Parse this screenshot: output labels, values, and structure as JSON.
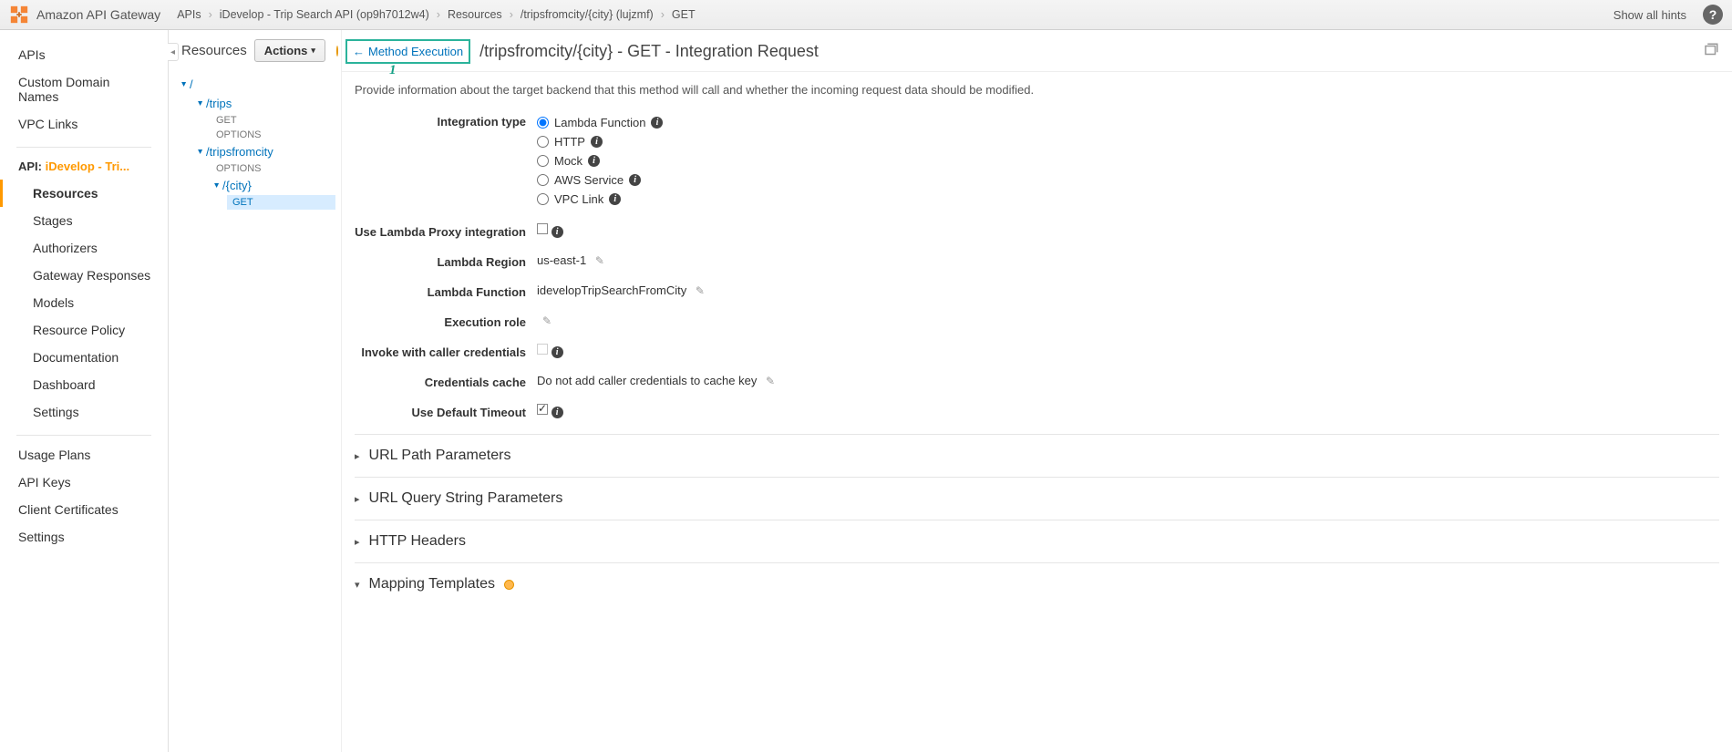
{
  "topbar": {
    "service_name": "Amazon API Gateway",
    "breadcrumbs": [
      "APIs",
      "iDevelop - Trip Search API (op9h7012w4)",
      "Resources",
      "/tripsfromcity/{city} (lujzmf)",
      "GET"
    ],
    "show_hints": "Show all hints"
  },
  "sidebar": {
    "items_top": [
      "APIs",
      "Custom Domain Names",
      "VPC Links"
    ],
    "api_prefix": "API:",
    "api_name": "iDevelop - Tri...",
    "api_items": [
      "Resources",
      "Stages",
      "Authorizers",
      "Gateway Responses",
      "Models",
      "Resource Policy",
      "Documentation",
      "Dashboard",
      "Settings"
    ],
    "items_bottom": [
      "Usage Plans",
      "API Keys",
      "Client Certificates",
      "Settings"
    ]
  },
  "resources": {
    "title": "Resources",
    "actions_label": "Actions",
    "tree": {
      "root": "/",
      "trips": "/trips",
      "trips_get": "GET",
      "trips_options": "OPTIONS",
      "tfc": "/tripsfromcity",
      "tfc_options": "OPTIONS",
      "city": "/{city}",
      "city_get": "GET"
    }
  },
  "main": {
    "back_link": "Method Execution",
    "annotation1": "1",
    "title": "/tripsfromcity/{city} - GET - Integration Request",
    "description": "Provide information about the target backend that this method will call and whether the incoming request data should be modified.",
    "labels": {
      "integration_type": "Integration type",
      "proxy": "Use Lambda Proxy integration",
      "region": "Lambda Region",
      "function": "Lambda Function",
      "exec_role": "Execution role",
      "invoke_caller": "Invoke with caller credentials",
      "cred_cache": "Credentials cache",
      "default_timeout": "Use Default Timeout"
    },
    "integration_options": [
      "Lambda Function",
      "HTTP",
      "Mock",
      "AWS Service",
      "VPC Link"
    ],
    "region_value": "us-east-1",
    "function_value": "idevelopTripSearchFromCity",
    "cred_cache_value": "Do not add caller credentials to cache key",
    "sections": [
      "URL Path Parameters",
      "URL Query String Parameters",
      "HTTP Headers",
      "Mapping Templates"
    ]
  }
}
